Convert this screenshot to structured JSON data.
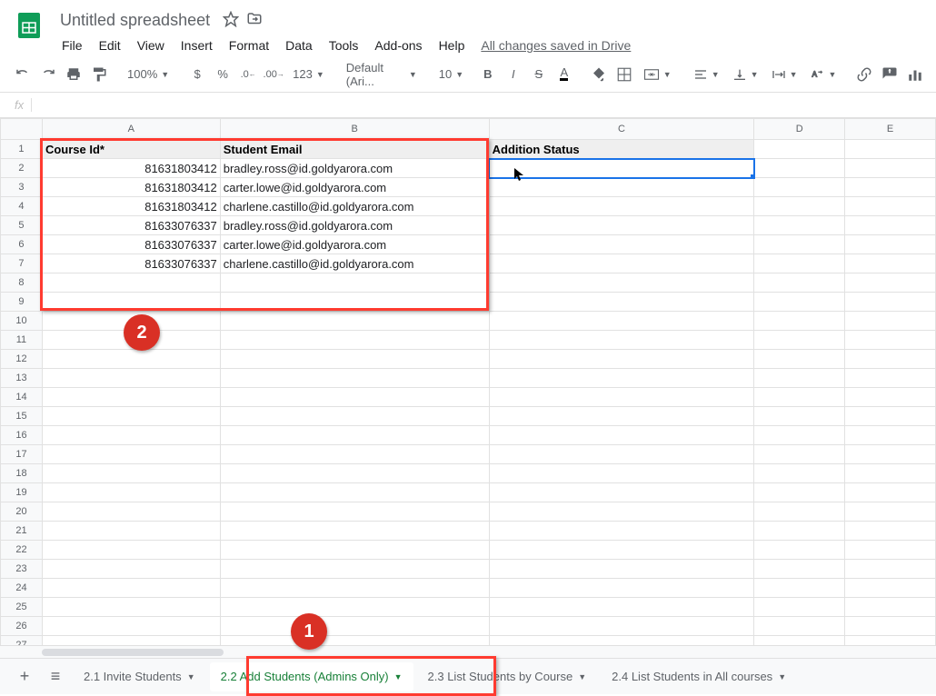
{
  "header": {
    "doc_title": "Untitled spreadsheet",
    "save_status": "All changes saved in Drive",
    "menus": [
      "File",
      "Edit",
      "View",
      "Insert",
      "Format",
      "Data",
      "Tools",
      "Add-ons",
      "Help"
    ]
  },
  "toolbar": {
    "zoom": "100%",
    "currency": "$",
    "percent": "%",
    "dec_dec": ".0",
    "inc_dec": ".00",
    "more_formats": "123",
    "font": "Default (Ari...",
    "font_size": "10"
  },
  "columns": [
    "A",
    "B",
    "C",
    "D",
    "E"
  ],
  "header_row": {
    "A": "Course Id*",
    "B": "Student Email",
    "C": "Addition Status"
  },
  "rows": [
    {
      "A": "81631803412",
      "B": "bradley.ross@id.goldyarora.com"
    },
    {
      "A": "81631803412",
      "B": "carter.lowe@id.goldyarora.com"
    },
    {
      "A": "81631803412",
      "B": "charlene.castillo@id.goldyarora.com"
    },
    {
      "A": "81633076337",
      "B": "bradley.ross@id.goldyarora.com"
    },
    {
      "A": "81633076337",
      "B": "carter.lowe@id.goldyarora.com"
    },
    {
      "A": "81633076337",
      "B": "charlene.castillo@id.goldyarora.com"
    }
  ],
  "badges": {
    "one": "1",
    "two": "2"
  },
  "sheet_tabs": {
    "add": "+",
    "all": "≡",
    "tabs": [
      "2.1 Invite Students",
      "2.2 Add Students (Admins Only)",
      "2.3 List Students by Course",
      "2.4 List Students in All courses"
    ],
    "active_index": 1
  }
}
